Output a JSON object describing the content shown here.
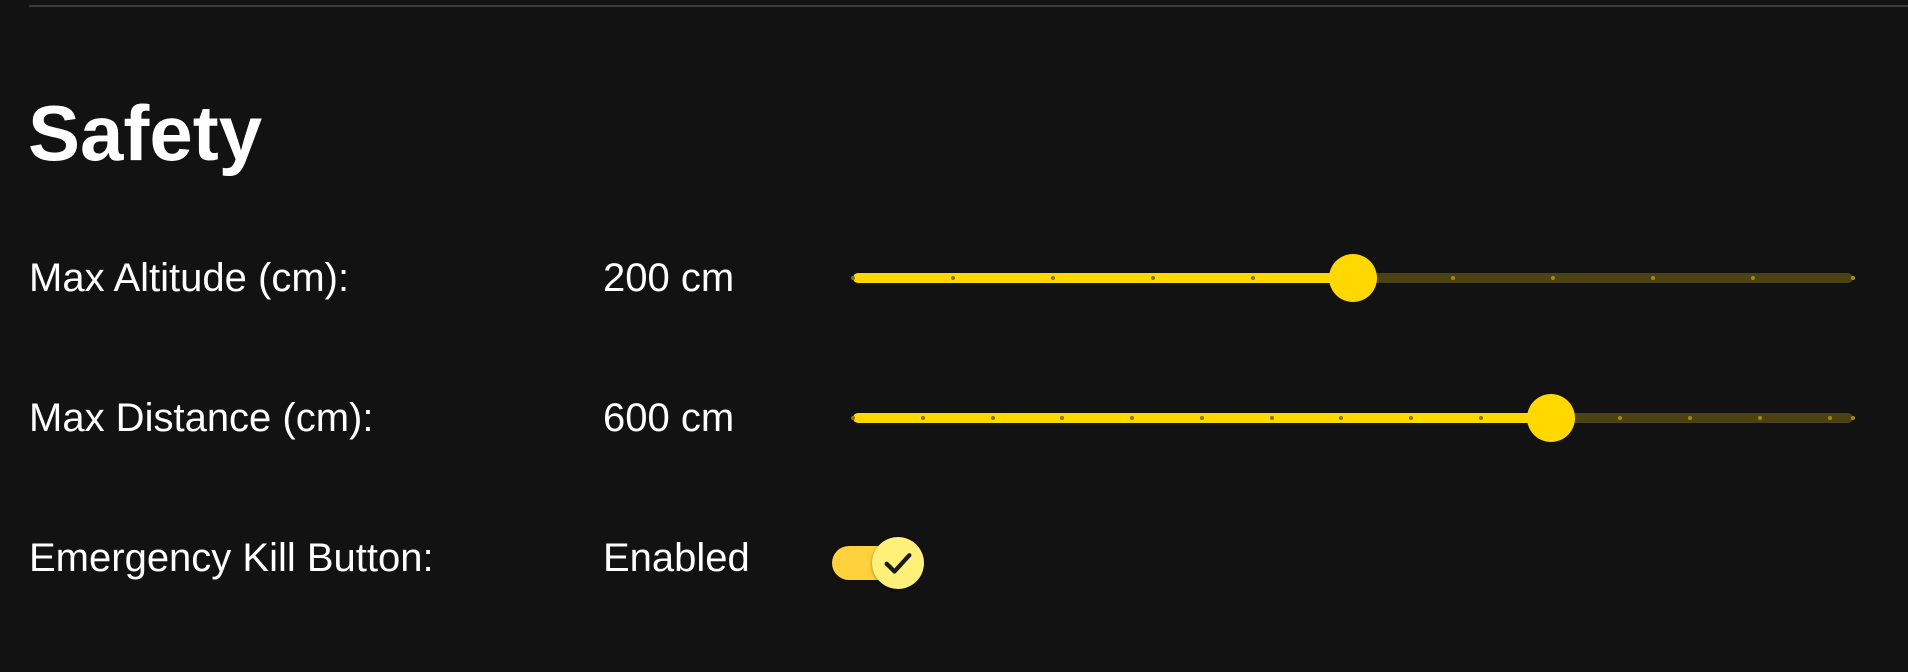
{
  "section": {
    "title": "Safety"
  },
  "settings": {
    "max_altitude": {
      "label": "Max Altitude (cm):",
      "value_text": "200 cm",
      "value": 200,
      "min": 0,
      "max": 400,
      "step": 40
    },
    "max_distance": {
      "label": "Max Distance (cm):",
      "value_text": "600 cm",
      "value": 600,
      "min": 0,
      "max": 860,
      "step": 60
    },
    "emergency_kill": {
      "label": "Emergency Kill Button:",
      "status_text": "Enabled",
      "enabled": true,
      "icon": "check-icon"
    }
  },
  "colors": {
    "background": "#121212",
    "accent": "#ffd800",
    "rail_inactive": "#4d4212",
    "toggle_track": "#ffd23d",
    "toggle_thumb": "#fff07a"
  }
}
